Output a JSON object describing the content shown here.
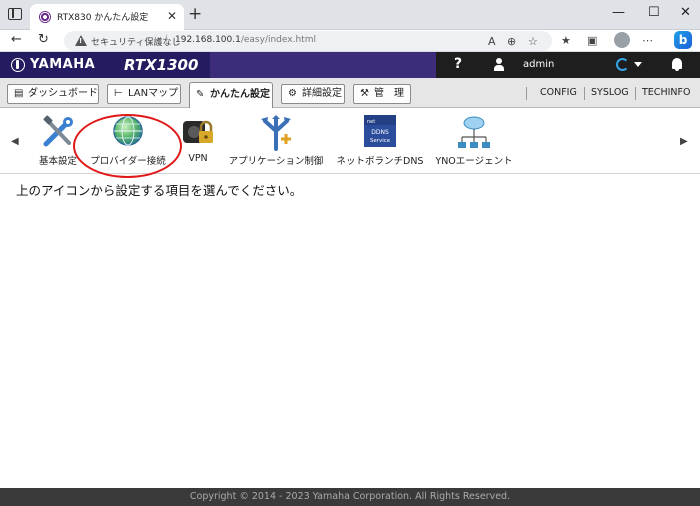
{
  "browser": {
    "tab_title": "RTX830 かんたん設定",
    "tab_close": "✕",
    "new_tab": "+",
    "window_controls": [
      "—",
      "☐",
      "✕"
    ],
    "security_label": "セキュリティ保護なし",
    "url_host": "192.168.100.1",
    "url_path": "/easy/index.html"
  },
  "header": {
    "brand": "YAMAHA",
    "model": "RTX1300",
    "help": "?",
    "user": "admin"
  },
  "tabs": [
    {
      "label": "ダッシュボード",
      "icon": "dashboard-icon",
      "glyph": "▤"
    },
    {
      "label": "LANマップ",
      "icon": "lanmap-icon",
      "glyph": "⊢"
    },
    {
      "label": "かんたん設定",
      "icon": "wizard-icon",
      "glyph": "✎",
      "active": true
    },
    {
      "label": "詳細設定",
      "icon": "gear-icon",
      "glyph": "⚙"
    },
    {
      "label": "管　理",
      "icon": "wrench-icon",
      "glyph": "🔧"
    }
  ],
  "top_links": [
    "CONFIG",
    "SYSLOG",
    "TECHINFO"
  ],
  "tools": [
    {
      "label": "基本設定",
      "icon": "tools-icon"
    },
    {
      "label": "プロバイダー接続",
      "icon": "globe-icon"
    },
    {
      "label": "VPN",
      "icon": "vpn-lock-icon"
    },
    {
      "label": "アプリケーション制御",
      "icon": "app-control-icon"
    },
    {
      "label": "ネットボランチDNS",
      "icon": "ddns-service-icon",
      "badge_lines": [
        "DDNS",
        "Service"
      ]
    },
    {
      "label": "YNOエージェント",
      "icon": "yno-network-icon"
    }
  ],
  "instruction": "上のアイコンから設定する項目を選んでください。",
  "footer": "Copyright © 2014 - 2023 Yamaha Corporation. All Rights Reserved."
}
